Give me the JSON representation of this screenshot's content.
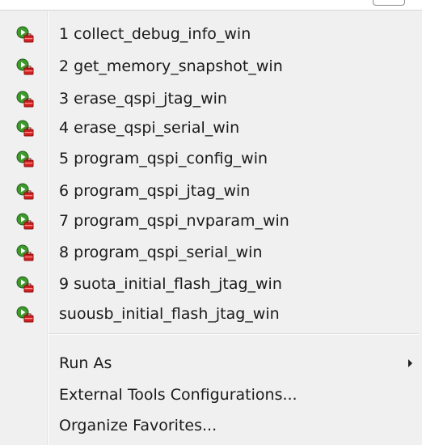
{
  "favorites": [
    {
      "label": "1 collect_debug_info_win",
      "icon": "run-external-tool-icon"
    },
    {
      "label": "2 get_memory_snapshot_win",
      "icon": "run-external-tool-icon"
    },
    {
      "label": "3 erase_qspi_jtag_win",
      "icon": "run-external-tool-icon"
    },
    {
      "label": "4 erase_qspi_serial_win",
      "icon": "run-external-tool-icon"
    },
    {
      "label": "5 program_qspi_config_win",
      "icon": "run-external-tool-icon"
    },
    {
      "label": "6 program_qspi_jtag_win",
      "icon": "run-external-tool-icon"
    },
    {
      "label": "7 program_qspi_nvparam_win",
      "icon": "run-external-tool-icon"
    },
    {
      "label": "8 program_qspi_serial_win",
      "icon": "run-external-tool-icon"
    },
    {
      "label": "9 suota_initial_flash_jtag_win",
      "icon": "run-external-tool-icon"
    },
    {
      "label": "suousb_initial_flash_jtag_win",
      "icon": "run-external-tool-icon"
    }
  ],
  "actions": {
    "run_as": "Run As",
    "external_tools_configurations": "External Tools Configurations...",
    "organize_favorites": "Organize Favorites..."
  },
  "colors": {
    "icon_green": "#3f9a2e",
    "icon_red": "#d42020",
    "menu_background": "#f0f0f0"
  }
}
